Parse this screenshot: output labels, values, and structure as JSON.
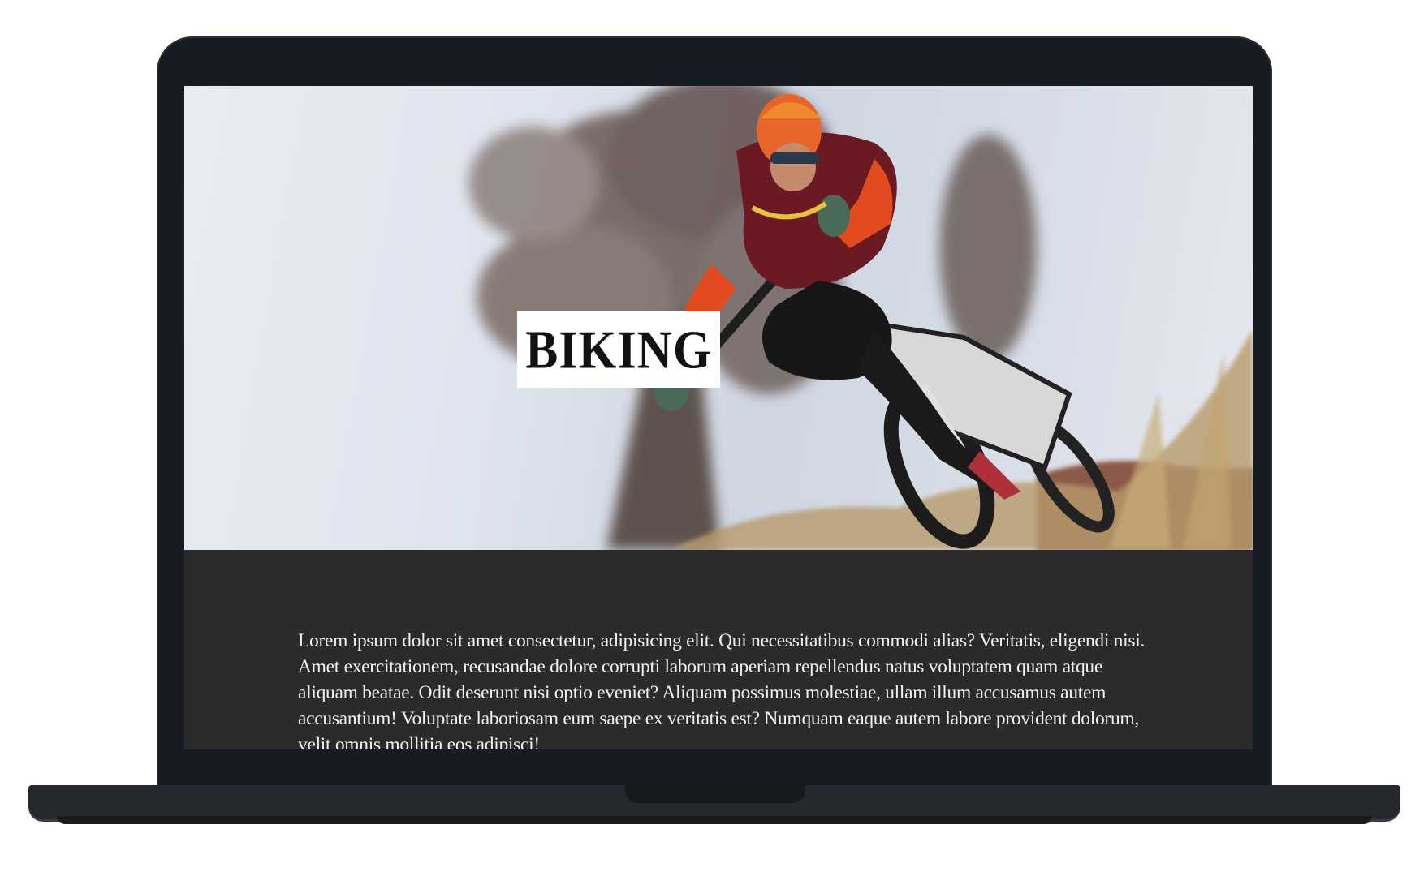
{
  "hero": {
    "title": "BIKING",
    "image_alt": "mountain-biker-photo"
  },
  "content": {
    "paragraph": "Lorem ipsum dolor sit amet consectetur, adipisicing elit. Qui necessitatibus commodi alias? Veritatis, eligendi nisi. Amet exercitationem, recusandae dolore corrupti laborum aperiam repellendus natus voluptatem quam atque aliquam beatae. Odit deserunt nisi optio eveniet? Aliquam possimus molestiae, ullam illum accusamus autem accusantium! Voluptate laboriosam eum saepe ex veritatis est? Numquam eaque autem labore provident dolorum, velit omnis mollitia eos adipisci!"
  },
  "colors": {
    "laptop_frame": "#171c22",
    "content_bg": "#2b2b2b",
    "text": "#f2f2f2",
    "title_box": "#ffffff"
  }
}
